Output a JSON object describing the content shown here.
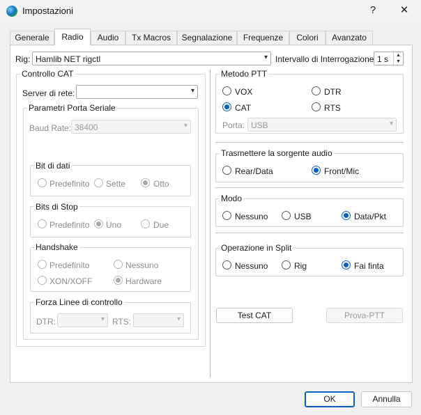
{
  "window": {
    "title": "Impostazioni",
    "help": "?",
    "close": "✕"
  },
  "tabs": [
    {
      "label": "Generale"
    },
    {
      "label": "Radio"
    },
    {
      "label": "Audio"
    },
    {
      "label": "Tx Macros"
    },
    {
      "label": "Segnalazione"
    },
    {
      "label": "Frequenze"
    },
    {
      "label": "Colori"
    },
    {
      "label": "Avanzato"
    }
  ],
  "rig": {
    "label": "Rig:",
    "value": "Hamlib NET rigctl",
    "poll_label": "Intervallo di Interrogazione:",
    "poll_value": "1 s"
  },
  "cat": {
    "title": "Controllo CAT",
    "server_label": "Server di rete:",
    "server_value": "",
    "serial": {
      "title": "Parametri Porta Seriale",
      "baud_label": "Baud Rate:",
      "baud_value": "38400",
      "data_bits": {
        "title": "Bit di dati",
        "options": [
          "Predefinito",
          "Sette",
          "Otto"
        ]
      },
      "stop_bits": {
        "title": "Bits di Stop",
        "options": [
          "Predefinito",
          "Uno",
          "Due"
        ]
      },
      "handshake": {
        "title": "Handshake",
        "options": [
          "Predefinito",
          "Nessuno",
          "XON/XOFF",
          "Hardware"
        ]
      },
      "control_lines": {
        "title": "Forza Linee di controllo",
        "dtr_label": "DTR:",
        "rts_label": "RTS:"
      }
    }
  },
  "ptt": {
    "title": "Metodo PTT",
    "options": [
      "VOX",
      "DTR",
      "CAT",
      "RTS"
    ],
    "port_label": "Porta:",
    "port_value": "USB"
  },
  "audio_src": {
    "title": "Trasmettere la sorgente audio",
    "options": [
      "Rear/Data",
      "Front/Mic"
    ]
  },
  "mode": {
    "title": "Modo",
    "options": [
      "Nessuno",
      "USB",
      "Data/Pkt"
    ]
  },
  "split": {
    "title": "Operazione in Split",
    "options": [
      "Nessuno",
      "Rig",
      "Fai finta"
    ]
  },
  "buttons": {
    "test_cat": "Test CAT",
    "test_ptt": "Prova-PTT",
    "ok": "OK",
    "cancel": "Annulla"
  },
  "icons": {
    "dropdown": "▾",
    "spin_up": "▲",
    "spin_down": "▼"
  }
}
